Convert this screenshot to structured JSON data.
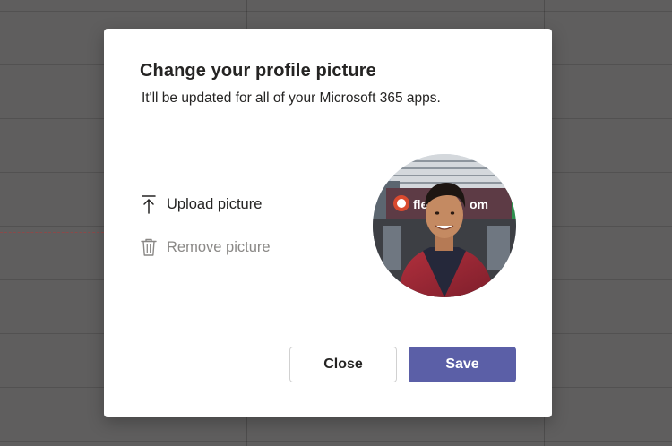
{
  "dialog": {
    "title": "Change your profile picture",
    "subtitle": "It'll be updated for all of your Microsoft 365 apps.",
    "actions": {
      "upload_label": "Upload picture",
      "upload_icon": "upload-icon",
      "remove_label": "Remove picture",
      "remove_icon": "trash-icon"
    },
    "buttons": {
      "close_label": "Close",
      "save_label": "Save"
    }
  },
  "colors": {
    "overlay": "#5f5e5e",
    "dialog_bg": "#ffffff",
    "primary": "#5b5fa7",
    "text": "#252423",
    "disabled_text": "#8a8886"
  }
}
